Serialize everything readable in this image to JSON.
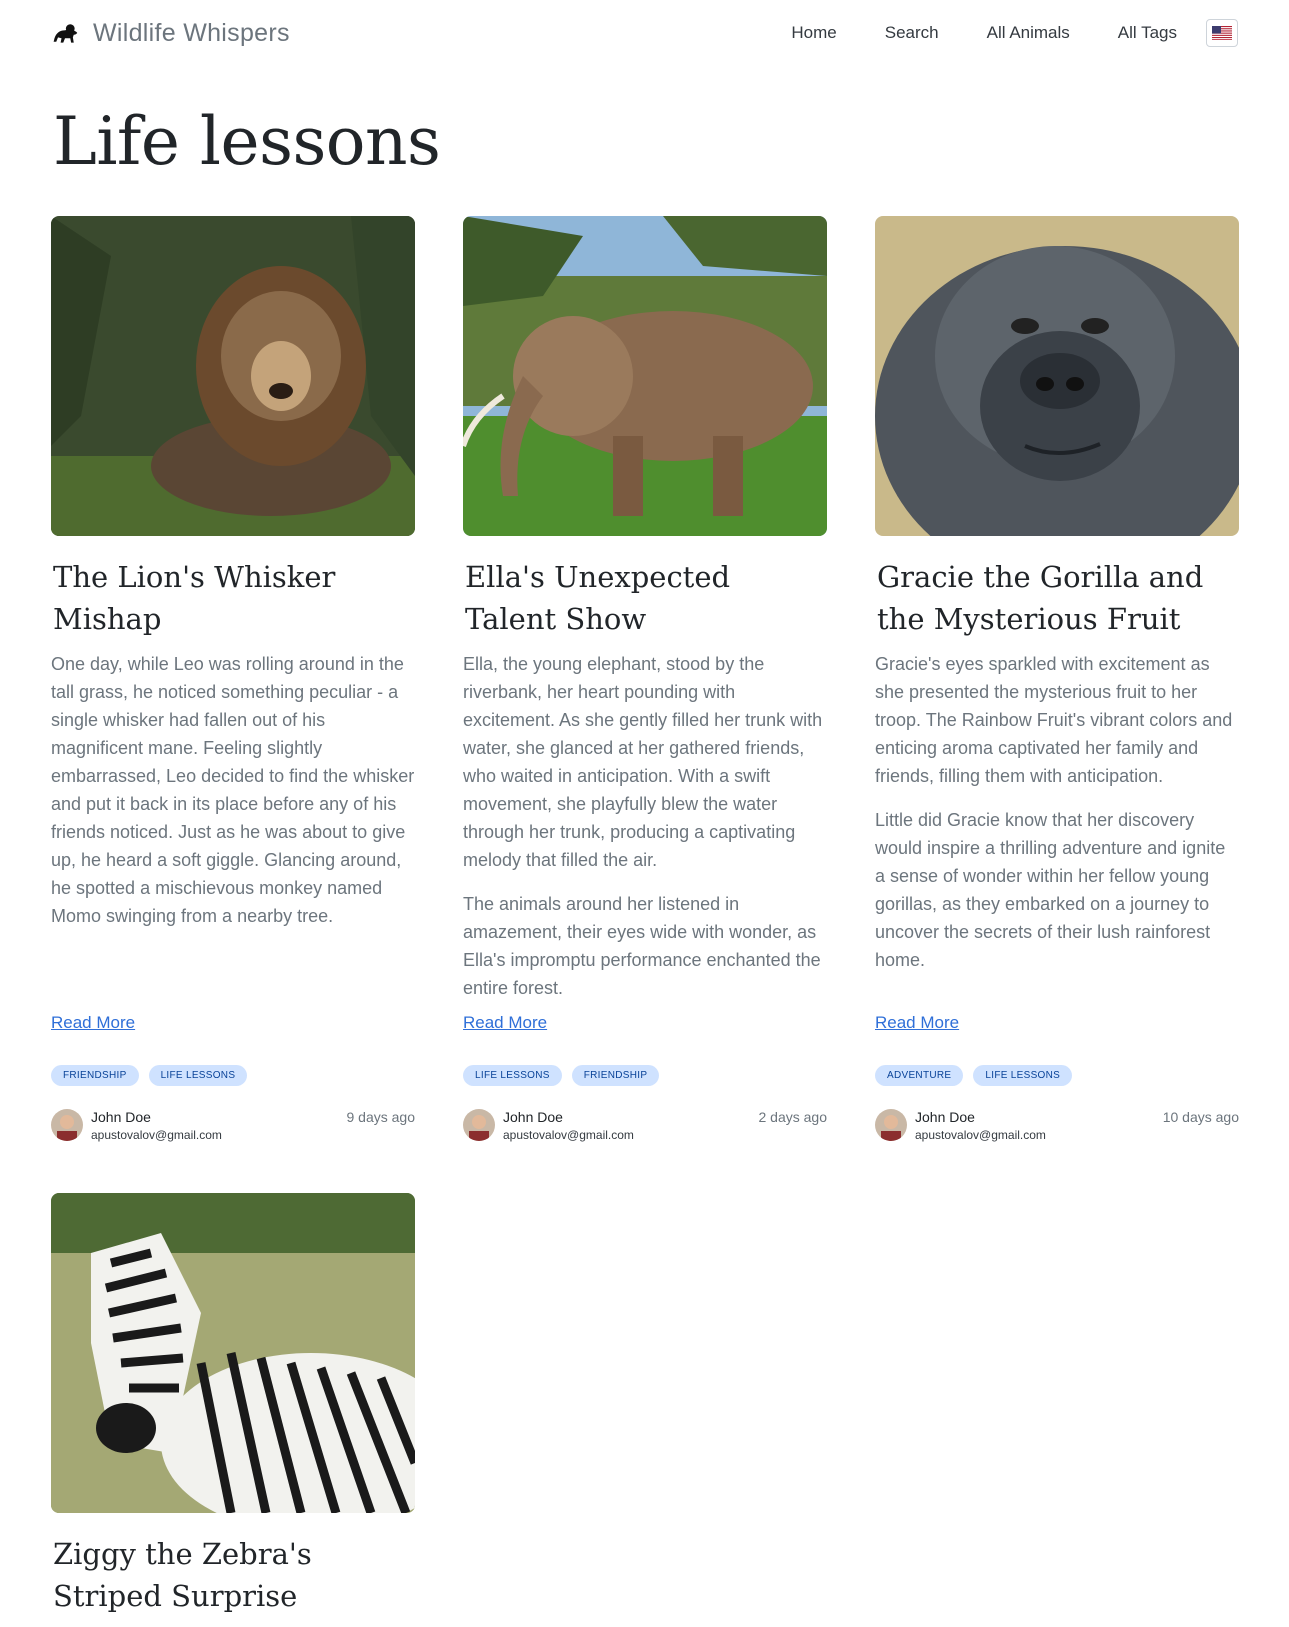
{
  "header": {
    "brand": "Wildlife Whispers",
    "nav": [
      "Home",
      "Search",
      "All Animals",
      "All Tags"
    ]
  },
  "page": {
    "title": "Life lessons"
  },
  "cards": [
    {
      "title": "The Lion's Whisker Mishap",
      "paragraphs": [
        "One day, while Leo was rolling around in the tall grass, he noticed something peculiar - a single whisker had fallen out of his magnificent mane. Feeling slightly embarrassed, Leo decided to find the whisker and put it back in its place before any of his friends noticed. Just as he was about to give up, he heard a soft giggle. Glancing around, he spotted a mischievous monkey named Momo swinging from a nearby tree."
      ],
      "read_more": "Read More",
      "tags": [
        "Friendship",
        "Life Lessons"
      ],
      "author_name": "John Doe",
      "author_email": "apustovalov@gmail.com",
      "time": "9 days ago",
      "image": "lion-photo"
    },
    {
      "title": "Ella's Unexpected Talent Show",
      "paragraphs": [
        "Ella, the young elephant, stood by the riverbank, her heart pounding with excitement. As she gently filled her trunk with water, she glanced at her gathered friends, who waited in anticipation. With a swift movement, she playfully blew the water through her trunk, producing a captivating melody that filled the air.",
        "The animals around her listened in amazement, their eyes wide with wonder, as Ella's impromptu performance enchanted the entire forest."
      ],
      "read_more": "Read More",
      "tags": [
        "Life Lessons",
        "Friendship"
      ],
      "author_name": "John Doe",
      "author_email": "apustovalov@gmail.com",
      "time": "2 days ago",
      "image": "elephant-photo"
    },
    {
      "title": "Gracie the Gorilla and the Mysterious Fruit",
      "paragraphs": [
        "Gracie's eyes sparkled with excitement as she presented the mysterious fruit to her troop. The Rainbow Fruit's vibrant colors and enticing aroma captivated her family and friends, filling them with anticipation.",
        "Little did Gracie know that her discovery would inspire a thrilling adventure and ignite a sense of wonder within her fellow young gorillas, as they embarked on a journey to uncover the secrets of their lush rainforest home."
      ],
      "read_more": "Read More",
      "tags": [
        "Adventure",
        "Life Lessons"
      ],
      "author_name": "John Doe",
      "author_email": "apustovalov@gmail.com",
      "time": "10 days ago",
      "image": "gorilla-photo"
    },
    {
      "title": "Ziggy the Zebra's Striped Surprise",
      "paragraphs": [],
      "image": "zebra-photo"
    }
  ],
  "colors": {
    "accent": "#2f6fd8",
    "tag_bg": "#cfe2ff",
    "tag_text": "#084298"
  }
}
